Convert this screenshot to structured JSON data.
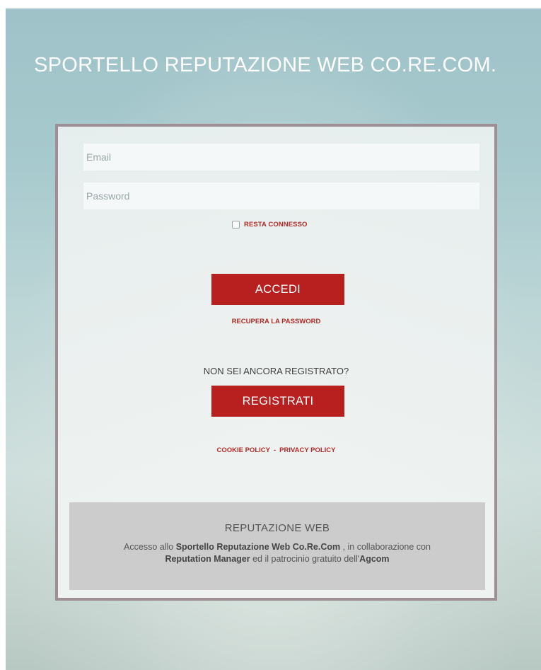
{
  "header": {
    "title": "SPORTELLO REPUTAZIONE WEB CO.RE.COM."
  },
  "login_form": {
    "email_placeholder": "Email",
    "password_placeholder": "Password",
    "remember_label": "RESTA CONNESSO",
    "login_label": "ACCEDI",
    "recover_label": "RECUPERA LA PASSWORD",
    "not_registered_text": "NON SEI ANCORA REGISTRATO?",
    "register_label": "REGISTRATI",
    "cookie_policy_label": "COOKIE POLICY",
    "separator": "-",
    "privacy_policy_label": "PRIVACY POLICY"
  },
  "info_box": {
    "title": "REPUTAZIONE WEB",
    "text_1": "Accesso allo ",
    "bold_1": "Sportello Reputazione Web Co.Re.Com",
    "text_2": " , in collaborazione con ",
    "bold_2": "Reputation Manager",
    "text_3": " ed il patrocinio gratuito dell'",
    "bold_3": "Agcom"
  },
  "colors": {
    "accent": "#b8201f",
    "link": "#b22a26",
    "panel_border": "#9e8f94",
    "info_bg": "#cccccc"
  }
}
